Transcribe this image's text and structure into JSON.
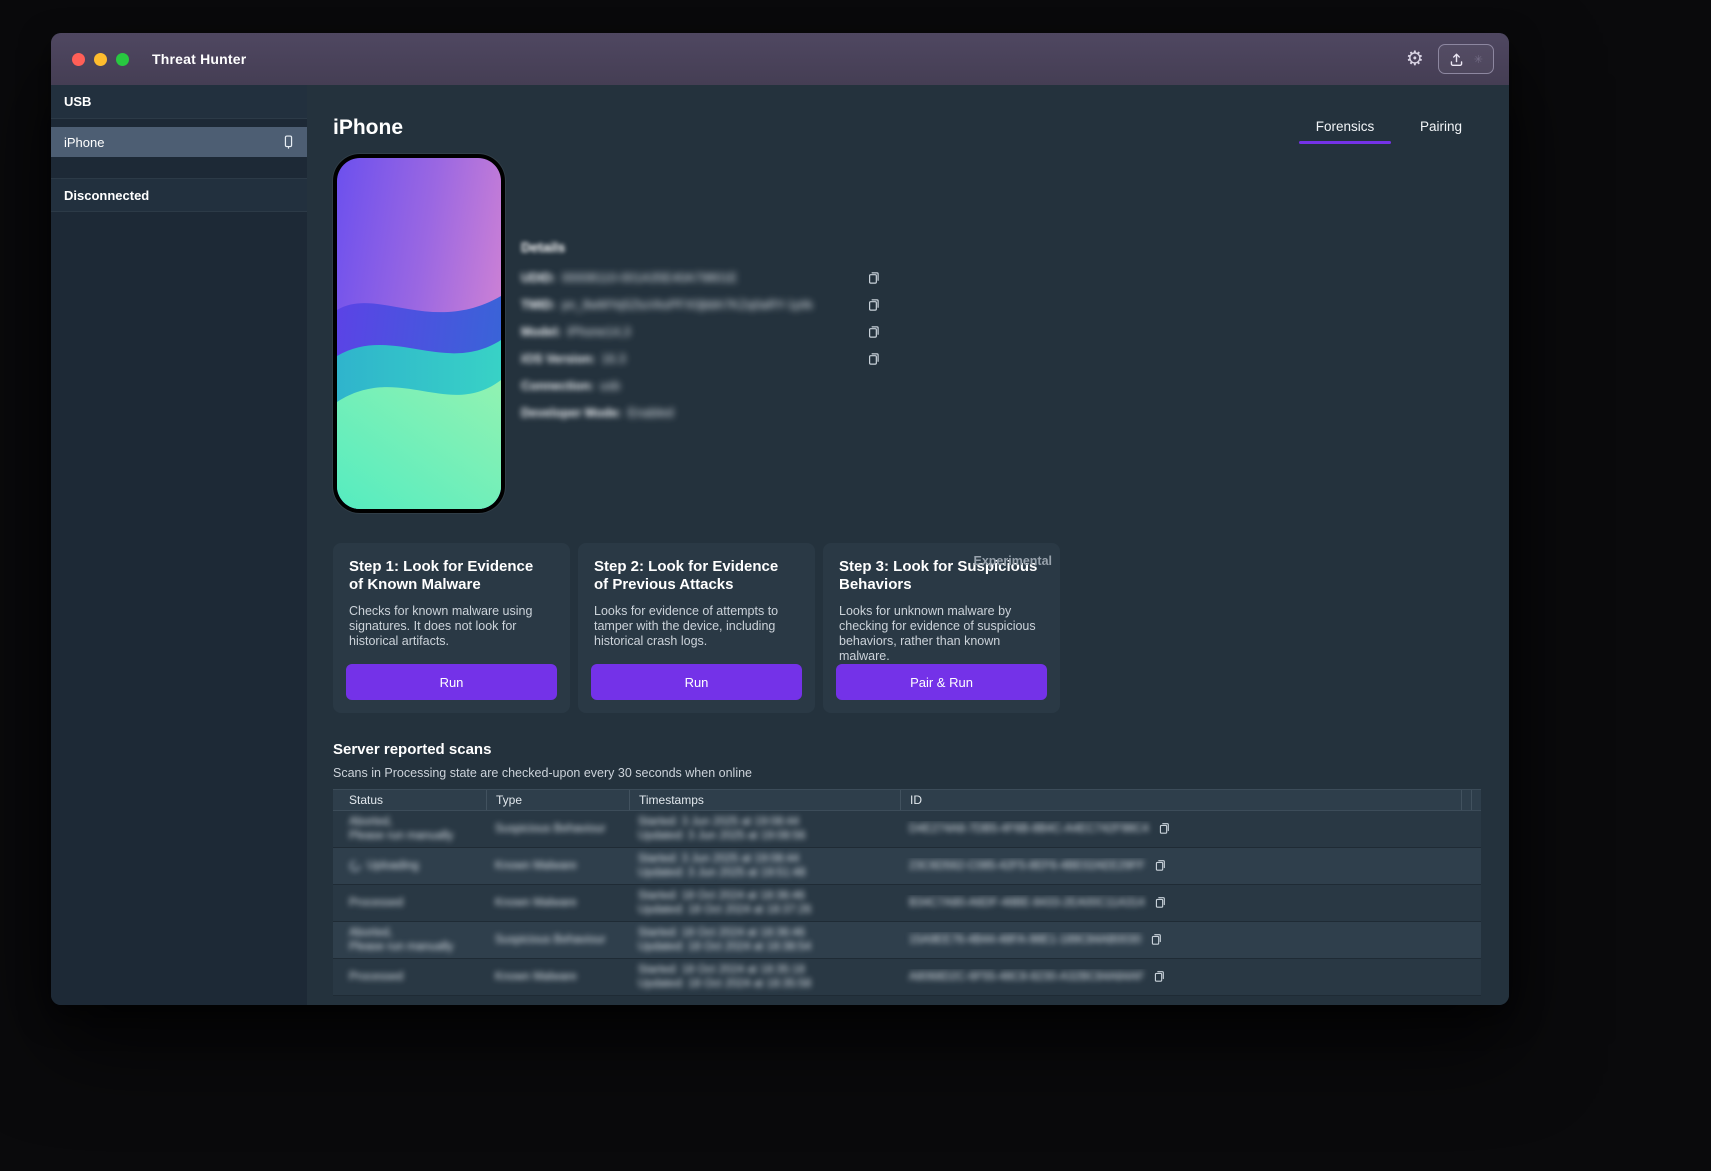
{
  "titlebar": {
    "title": "Threat Hunter"
  },
  "sidebar": {
    "usb_header": "USB",
    "device_item": "iPhone",
    "disconnected_header": "Disconnected"
  },
  "page": {
    "title": "iPhone",
    "tabs": {
      "forensics": "Forensics",
      "pairing": "Pairing"
    }
  },
  "details": {
    "heading": "Details",
    "rows": [
      {
        "label": "UDID:",
        "value": "00008110-001A35E40A79801E"
      },
      {
        "label": "TMID:",
        "value": "pn_8wMYq5ZtuVksPFX0jbbh7KZq0aRY-1pWAQ"
      },
      {
        "label": "Model:",
        "value": "iPhone14,3"
      },
      {
        "label": "iOS Version:",
        "value": "16.3"
      },
      {
        "label": "Connection:",
        "value": "usb"
      },
      {
        "label": "Developer Mode:",
        "value": "Enabled"
      }
    ]
  },
  "steps": [
    {
      "title": "Step 1: Look for Evidence of Known Malware",
      "description": "Checks for known malware using signatures. It does not look for historical artifacts.",
      "button": "Run"
    },
    {
      "title": "Step 2: Look for Evidence of Previous Attacks",
      "description": "Looks for evidence of attempts to tamper with the device, including historical crash logs.",
      "button": "Run"
    },
    {
      "title": "Step 3: Look for Suspicious Behaviors",
      "description": "Looks for unknown malware by checking for evidence of suspicious behaviors, rather than known malware.",
      "button": "Pair & Run",
      "badge": "Experimental"
    }
  ],
  "scans": {
    "heading": "Server reported scans",
    "note": "Scans in Processing state are checked-upon every 30 seconds when online",
    "columns": [
      "Status",
      "Type",
      "Timestamps",
      "ID"
    ],
    "rows": [
      {
        "status": "Aborted,\nPlease run manually",
        "type": "Suspicious Behaviour",
        "timestamps": "Started:  3 Jun 2025 at 19:08:44\nUpdated:  3 Jun 2025 at 19:08:56",
        "id": "D4E274A8-7DB5-4F6B-8B4C-A4EC742F98C4"
      },
      {
        "status": "Uploading",
        "type": "Known Malware",
        "timestamps": "Started:  3 Jun 2025 at 19:08:44\nUpdated:  3 Jun 2025 at 19:51:48",
        "id": "23C6D562-C085-42F5-8EF6-4BE02AEE29FF"
      },
      {
        "status": "Processed",
        "type": "Known Malware",
        "timestamps": "Started: 18 Oct 2024 at 18:36:46\nUpdated: 18 Oct 2024 at 18:37:26",
        "id": "B34C7A80-A6DF-48BE-8433-2EA00C11A314"
      },
      {
        "status": "Aborted,\nPlease run manually",
        "type": "Suspicious Behaviour",
        "timestamps": "Started: 18 Oct 2024 at 18:36:46\nUpdated: 18 Oct 2024 at 18:38:54",
        "id": "15A9EE76-4B44-48FA-98E1-189C84AB0030"
      },
      {
        "status": "Processed",
        "type": "Known Malware",
        "timestamps": "Started: 18 Oct 2024 at 18:35:18\nUpdated: 18 Oct 2024 at 18:35:58",
        "id": "A8068D2C-6F55-48C8-8230-A32BC84A84AF"
      }
    ]
  }
}
